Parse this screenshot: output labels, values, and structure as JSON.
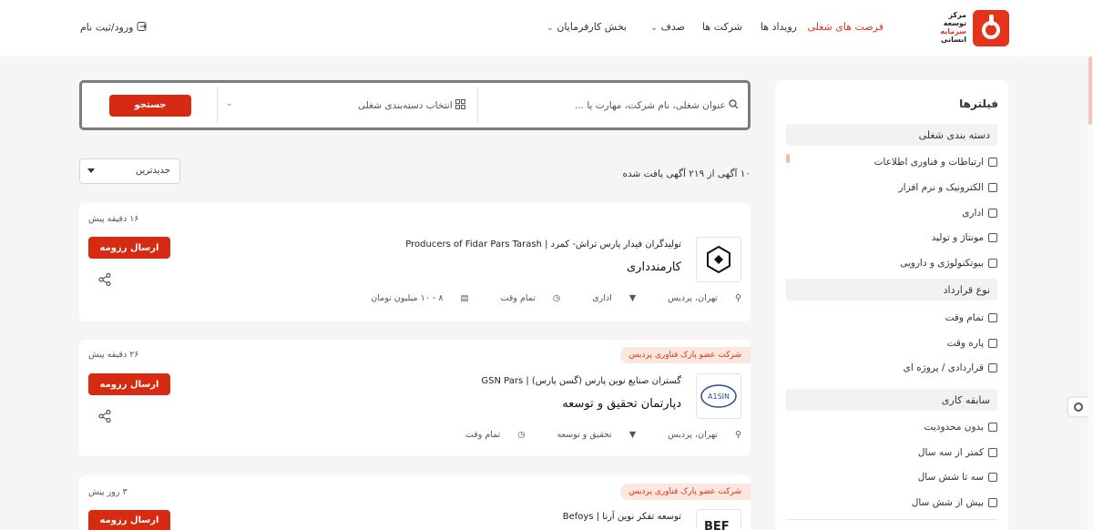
{
  "brand": {
    "logo_lines": [
      "مرکز",
      "توسعه",
      "سرمایه",
      "انسانی"
    ],
    "accent": "#e4321b"
  },
  "nav": {
    "jobs": "فرصت های شغلی",
    "events": "رویداد ها",
    "companies": "شرکت ها",
    "sadaf": "صدف",
    "employers": "بخش کارفرمایان",
    "login": "ورود/ثبت نام"
  },
  "search": {
    "placeholder": "عنوان شغلی، نام شرکت، مهارت یا ...",
    "category_placeholder": "انتخاب دسته‌بندی شغلی",
    "button": "جستجو"
  },
  "sort": {
    "selected": "جدیدترین"
  },
  "results": {
    "count_text": "۱۰ آگهی از ۲۱۹ آگهی یافت شده"
  },
  "filters": {
    "title": "فیلترها",
    "sections": [
      {
        "title": "دسته بندی شغلی",
        "options": [
          "ارتباطات و فناوری اطلاعات",
          "الکترونیک و نرم افزار",
          "اداری",
          "مونتاژ و تولید",
          "بیوتکنولوژی و دارویی"
        ]
      },
      {
        "title": "نوع قرارداد",
        "options": [
          "تمام وقت",
          "پاره وقت",
          "قراردادی / پروژه ای"
        ]
      },
      {
        "title": "سابقه کاری",
        "options": [
          "بدون محدودیت",
          "کمتر از سه سال",
          "سه تا شش سال",
          "بیش از شش سال"
        ]
      }
    ]
  },
  "jobs": [
    {
      "time": "۱۶ دقیقه پیش",
      "badge": "",
      "company": "تولیدگران فیدار پارس تراش- کمرد | Producers of Fidar Pars Tarash",
      "title": "کارمندداری",
      "location": "تهران، پردیس",
      "category": "اداری",
      "type": "تمام وقت",
      "salary": "۸ - ۱۰ میلیون تومان",
      "apply": "ارسال رزومه"
    },
    {
      "time": "۲۶ دقیقه پیش",
      "badge": "شرکت عضو پارک فناوری پردیس",
      "company": "گستران صنایع نوین پارس (گسن پارس) | GSN Pars",
      "title": "دپارتمان تحقیق و توسعه",
      "location": "تهران، پردیس",
      "category": "تحقیق و توسعه",
      "type": "تمام وقت",
      "salary": "",
      "apply": "ارسال رزومه",
      "logo_text": "A1SIN"
    },
    {
      "time": "۳ روز پیش",
      "badge": "شرکت عضو پارک فناوری پردیس",
      "company": "توسعه تفکر نوین آرنا | Befoys",
      "title": "",
      "apply": "ارسال رزومه",
      "logo_text": "BEF"
    }
  ]
}
